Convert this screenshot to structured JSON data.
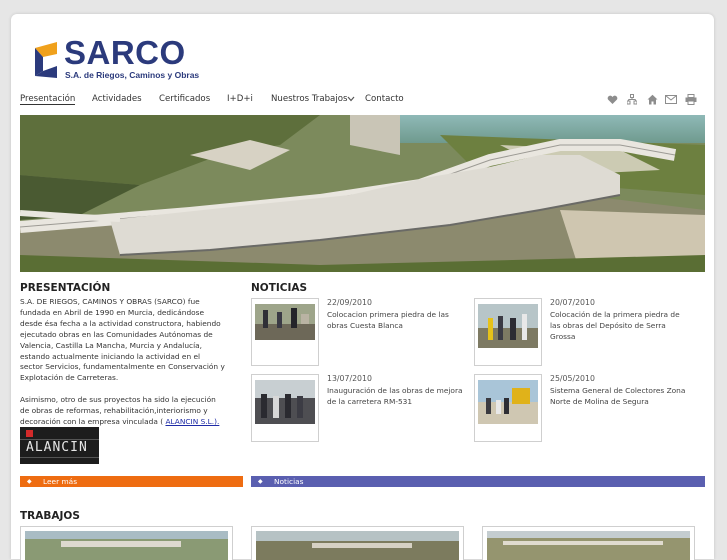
{
  "brand": {
    "name": "SARCO",
    "tagline": "S.A. de Riegos, Caminos y Obras"
  },
  "nav": {
    "items": [
      "Presentación",
      "Actividades",
      "Certificados",
      "I+D+i",
      "Nuestros Trabajos",
      "Contacto"
    ],
    "active": "Presentación"
  },
  "tools": [
    "heart-icon",
    "sitemap-icon",
    "home-icon",
    "mail-icon",
    "print-icon"
  ],
  "presentation": {
    "title": "PRESENTACIÓN",
    "lines": [
      "S.A. DE RIEGOS, CAMINOS Y OBRAS (SARCO) fue",
      "fundada en Abril de 1990 en Murcia, dedicándose",
      "desde ésa fecha a la actividad constructora, habiendo",
      "ejecutado obras en las Comunidades Autónomas de",
      "Valencia, Castilla La Mancha, Murcia y Andalucía,",
      "estando actualmente iniciando la actividad en el",
      "sector Servicios, fundamentalmente en Conservación y",
      "Explotación de Carreteras."
    ],
    "lines2": [
      "Asimismo, otro de sus proyectos ha sido la ejecución",
      "de obras de reformas, rehabilitación,interiorismo y"
    ],
    "last_prefix": "decoración con la empresa vinculada (",
    "link": "ALANCIN S.L.).",
    "alancin_logo": "ALANCIN",
    "read_more": "Leer más"
  },
  "news": {
    "title": "NOTICIAS",
    "items": [
      {
        "date": "22/09/2010",
        "title": "Colocacion primera piedra de las obras Cuesta Blanca"
      },
      {
        "date": "20/07/2010",
        "title": "Colocación de la primera piedra de las obras del Depósito de Serra Grossa"
      },
      {
        "date": "13/07/2010",
        "title": "Inauguración de las obras de mejora de la carretera RM-531"
      },
      {
        "date": "25/05/2010",
        "title": "Sistema General de Colectores Zona Norte de Molina de Segura"
      }
    ],
    "bar_label": "Noticias"
  },
  "works": {
    "title": "TRABAJOS"
  },
  "colors": {
    "brand_blue": "#2b3a7c",
    "orange": "#ee6c11",
    "purple": "#5a5fb0",
    "logo_orange": "#f0a11c"
  }
}
